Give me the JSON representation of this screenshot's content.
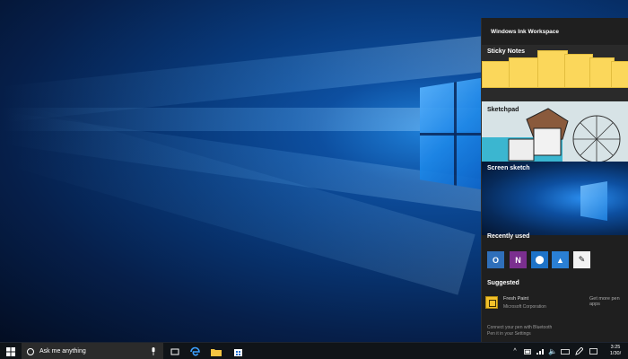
{
  "ink_workspace": {
    "title": "Windows Ink Workspace",
    "tiles": {
      "sticky_notes": "Sticky Notes",
      "sketchpad": "Sketchpad",
      "screen_sketch": "Screen sketch"
    },
    "recently_used": {
      "label": "Recently used",
      "apps": [
        {
          "icon": "outlook-icon",
          "color": "#2f6fba",
          "glyph": "O"
        },
        {
          "icon": "onenote-icon",
          "color": "#7b2f8f",
          "glyph": "N"
        },
        {
          "icon": "maps-icon",
          "color": "#1e73c8",
          "glyph": "⬤"
        },
        {
          "icon": "photos-icon",
          "color": "#2a7fd4",
          "glyph": "▲"
        },
        {
          "icon": "pen-app-icon",
          "color": "#f2f2f2",
          "glyph": "✎"
        }
      ]
    },
    "suggested": {
      "label": "Suggested",
      "app_name": "Fresh Paint",
      "app_publisher": "Microsoft Corporation",
      "get_more": "Get more pen apps",
      "pen_note_line1": "Connect your pen with Bluetooth",
      "pen_note_line2": "Pen it in your Settings"
    }
  },
  "taskbar": {
    "search_placeholder": "Ask me anything",
    "clock_time": "3:25",
    "clock_date": "1/30/",
    "accent": "#101418"
  }
}
